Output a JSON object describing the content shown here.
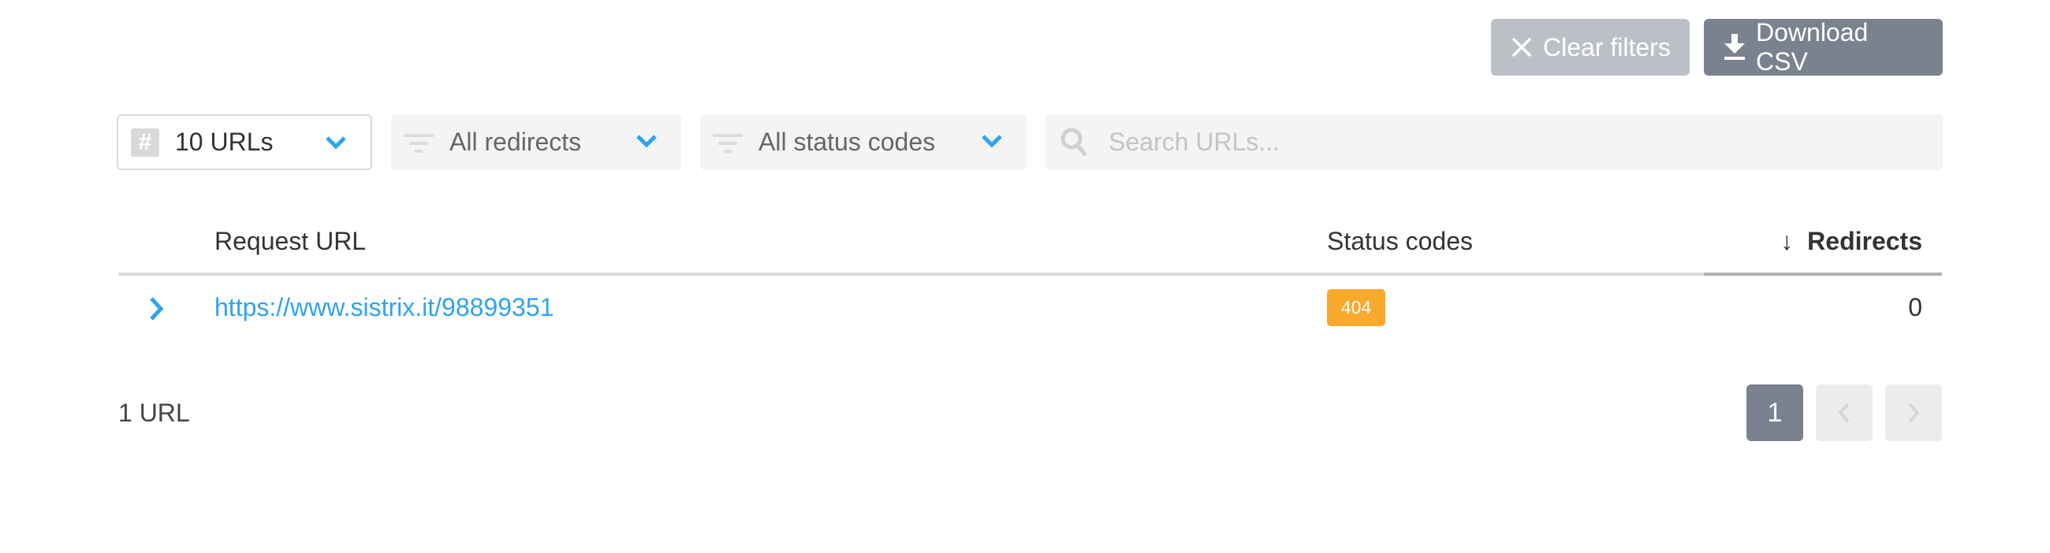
{
  "toolbar": {
    "clear_filters_label": "Clear filters",
    "clear_filters_icon": "close-icon",
    "download_csv_label": "Download CSV",
    "download_csv_icon": "download-icon"
  },
  "filters": {
    "page_size": {
      "value": "10 URLs",
      "icon": "hash-icon"
    },
    "redirects": {
      "value": "All redirects",
      "icon": "filter-icon"
    },
    "status_codes": {
      "value": "All status codes",
      "icon": "filter-icon"
    },
    "search": {
      "placeholder": "Search URLs...",
      "value": "",
      "icon": "search-icon"
    }
  },
  "table": {
    "columns": {
      "request_url": "Request URL",
      "status_codes": "Status codes",
      "redirects": "Redirects",
      "sort_indicator": "↓"
    },
    "rows": [
      {
        "url": "https://www.sistrix.it/98899351",
        "status_code": "404",
        "redirects": "0"
      }
    ]
  },
  "footer": {
    "count_label": "1 URL",
    "pagination": {
      "current_page": "1"
    }
  },
  "colors": {
    "accent": "#2ea3f2",
    "badge_404": "#fba92c",
    "primary_button": "#7a828f",
    "disabled_button": "#bcc0c6"
  }
}
